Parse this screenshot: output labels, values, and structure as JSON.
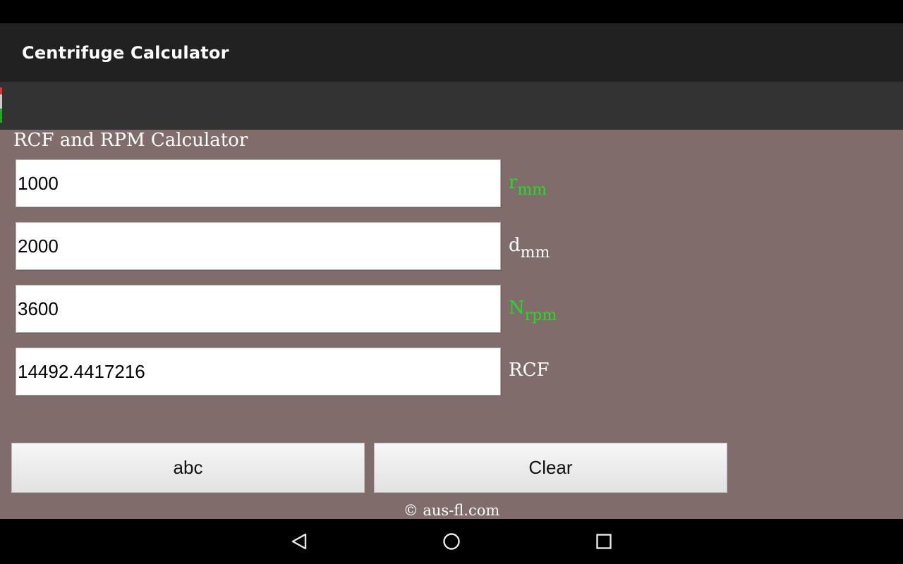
{
  "app": {
    "title": "Centrifuge Calculator"
  },
  "main": {
    "section_title": "RCF and RPM Calculator",
    "fields": [
      {
        "value": "1000",
        "unit": "r",
        "unit_sub": "mm",
        "unit_color": "#22dd22"
      },
      {
        "value": "2000",
        "unit": "d",
        "unit_sub": "mm",
        "unit_color": "#ffffff"
      },
      {
        "value": "3600",
        "unit": "N",
        "unit_sub": "rpm",
        "unit_color": "#22dd22"
      },
      {
        "value": "14492.4417216",
        "unit": "RCF",
        "unit_sub": "",
        "unit_color": "#ffffff"
      }
    ],
    "buttons": {
      "left_label": "abc",
      "right_label": "Clear"
    },
    "copyright": "© aus-fl.com"
  },
  "nav": {
    "icons": [
      "back-icon",
      "home-icon",
      "recents-icon"
    ]
  },
  "colors": {
    "content_bg": "#7f6c6b",
    "action_bar": "#212121",
    "ad_strip": "#333333",
    "highlight_unit": "#22dd22"
  }
}
